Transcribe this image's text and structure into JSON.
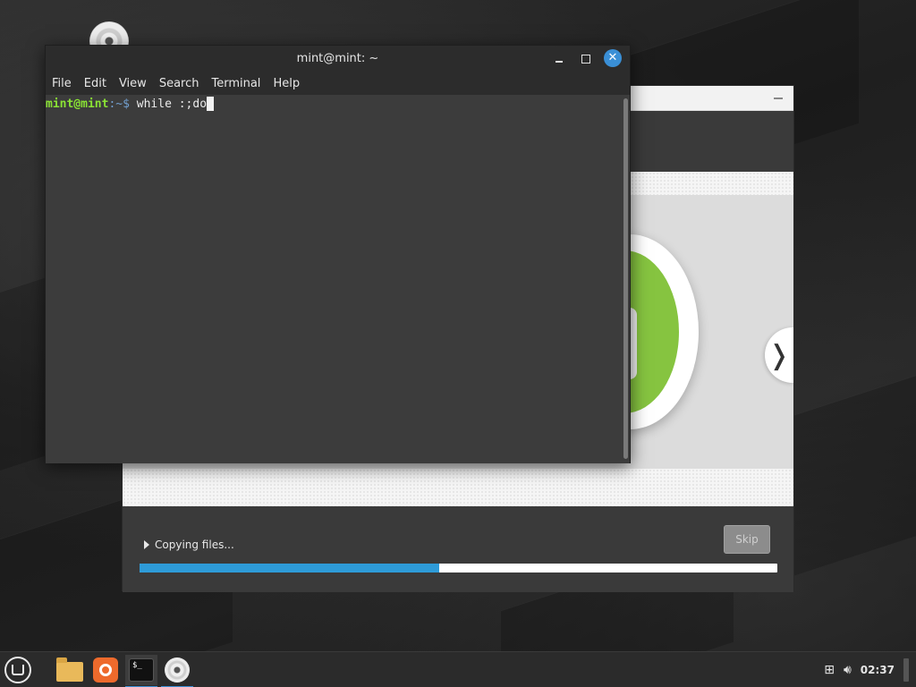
{
  "terminal": {
    "title": "mint@mint: ~",
    "menu": [
      "File",
      "Edit",
      "View",
      "Search",
      "Terminal",
      "Help"
    ],
    "prompt_user": "mint@mint",
    "prompt_path": ":~$ ",
    "command": "while :;do",
    "close_glyph": "✕"
  },
  "installer": {
    "status_text": "Copying files...",
    "skip_label": "Skip",
    "next_glyph": "❭",
    "progress_fraction": 0.47
  },
  "taskbar": {
    "clock": "02:37",
    "terminal_icon_text": "$_",
    "icons": [
      "mint-menu-icon",
      "files-icon",
      "firefox-like-icon",
      "terminal-icon",
      "disc-icon",
      "network-icon",
      "volume-icon"
    ]
  },
  "colors": {
    "accent": "#3a8fd6",
    "progress": "#2e9bd8",
    "mint_green": "#86c440",
    "prompt_green": "#8ae234"
  }
}
